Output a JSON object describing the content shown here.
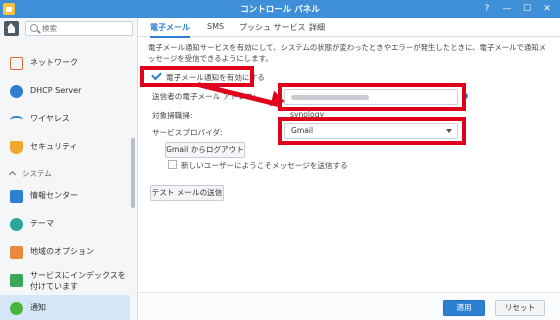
{
  "window": {
    "title": "コントロール パネル",
    "help": "?",
    "minimize": "—",
    "maximize": "☐",
    "close": "✕"
  },
  "search": {
    "placeholder": "検索"
  },
  "sidebar": {
    "items": [
      {
        "label": "ネットワーク"
      },
      {
        "label": "DHCP Server"
      },
      {
        "label": "ワイヤレス"
      },
      {
        "label": "セキュリティ"
      },
      {
        "label": "情報センター"
      },
      {
        "label": "テーマ"
      },
      {
        "label": "地域のオプション"
      },
      {
        "label": "サービスにインデックスを付けています"
      },
      {
        "label": "通知"
      }
    ],
    "section": "システム"
  },
  "tabs": [
    "電子メール",
    "SMS",
    "プッシュ サービス",
    "詳細"
  ],
  "form": {
    "description": "電子メール通知サービスを有効にして、システムの状態が変わったときやエラーが発生したときに、電子メールで通知メッセージを受信できるようにします。",
    "enable_label": "電子メール通知を有効にする",
    "sender_label": "送信者の電子メール アドレス:",
    "hostname_label": "対象掃職掃:",
    "hostname_value": "synology",
    "provider_label": "サービスプロバイダ:",
    "provider_value": "Gmail",
    "logout_label": "Gmail からログアウト",
    "welcome_label": "新しいユーザーにようこそメッセージを送信する",
    "test_label": "テスト メールの送信"
  },
  "footer": {
    "apply": "適用",
    "reset": "リセット"
  },
  "colors": {
    "accent": "#2d7fd1",
    "highlight": "#e0001b",
    "titlebar": "#3f8fd8"
  }
}
